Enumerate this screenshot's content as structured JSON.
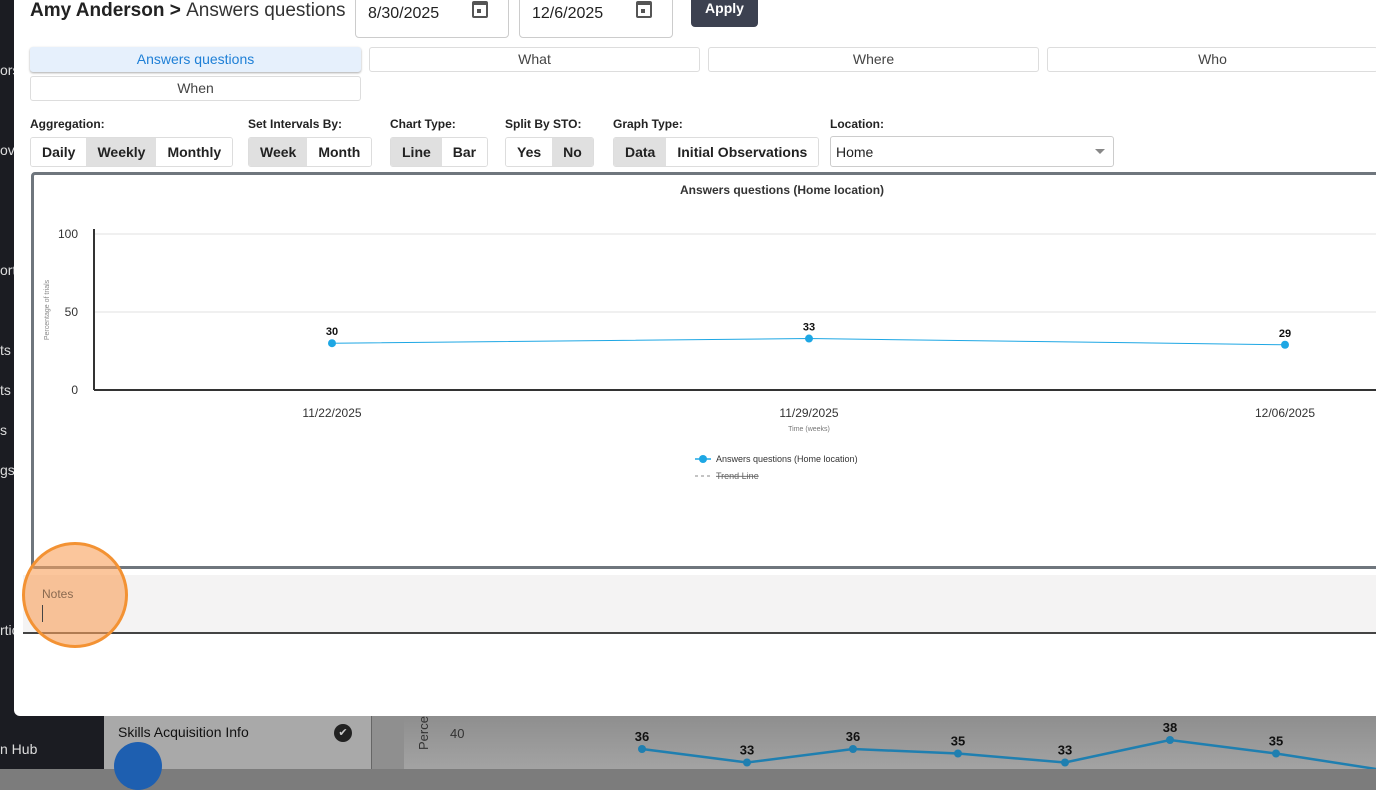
{
  "background": {
    "sidebar_fragments": [
      "ors",
      "ovi",
      "ort",
      "ts",
      "ts",
      "s",
      "gs",
      "rtic",
      "n Hub"
    ],
    "skills_label": "Skills Acquisition Info",
    "y_label_fragment": "Perce",
    "y_tick": "40",
    "values": [
      "36",
      "33",
      "36",
      "35",
      "33",
      "38",
      "35"
    ]
  },
  "header": {
    "student": "Amy Anderson >",
    "goal": "Answers questions",
    "start_date": "8/30/2025",
    "end_date": "12/6/2025",
    "apply_label": "Apply"
  },
  "tabs": [
    {
      "label": "Answers questions"
    },
    {
      "label": "What"
    },
    {
      "label": "Where"
    },
    {
      "label": "Who"
    },
    {
      "label": "When"
    }
  ],
  "controls": {
    "aggregation": {
      "label": "Aggregation:",
      "options": [
        "Daily",
        "Weekly",
        "Monthly"
      ],
      "selected": "Weekly"
    },
    "intervals": {
      "label": "Set Intervals By:",
      "options": [
        "Week",
        "Month"
      ],
      "selected": "Week"
    },
    "chart_type": {
      "label": "Chart Type:",
      "options": [
        "Line",
        "Bar"
      ],
      "selected": "Line"
    },
    "split": {
      "label": "Split By STO:",
      "options": [
        "Yes",
        "No"
      ],
      "selected": "No"
    },
    "graph_type": {
      "label": "Graph Type:",
      "options": [
        "Data",
        "Initial Observations"
      ],
      "selected": "Data"
    },
    "location": {
      "label": "Location:",
      "value": "Home"
    }
  },
  "chart_data": {
    "type": "line",
    "title": "Answers questions (Home location)",
    "xlabel": "Time (weeks)",
    "ylabel": "Percentage of trials",
    "ylim": [
      0,
      100
    ],
    "yticks": [
      "0",
      "50",
      "100"
    ],
    "categories": [
      "11/22/2025",
      "11/29/2025",
      "12/06/2025"
    ],
    "series": [
      {
        "name": "Answers questions (Home location)",
        "values": [
          30,
          33,
          29
        ],
        "color": "#1ea7e4"
      }
    ],
    "legend": [
      "Answers questions (Home location)",
      "Trend Line"
    ],
    "legend_position": "bottom"
  },
  "notes": {
    "label": "Notes",
    "value": ""
  }
}
